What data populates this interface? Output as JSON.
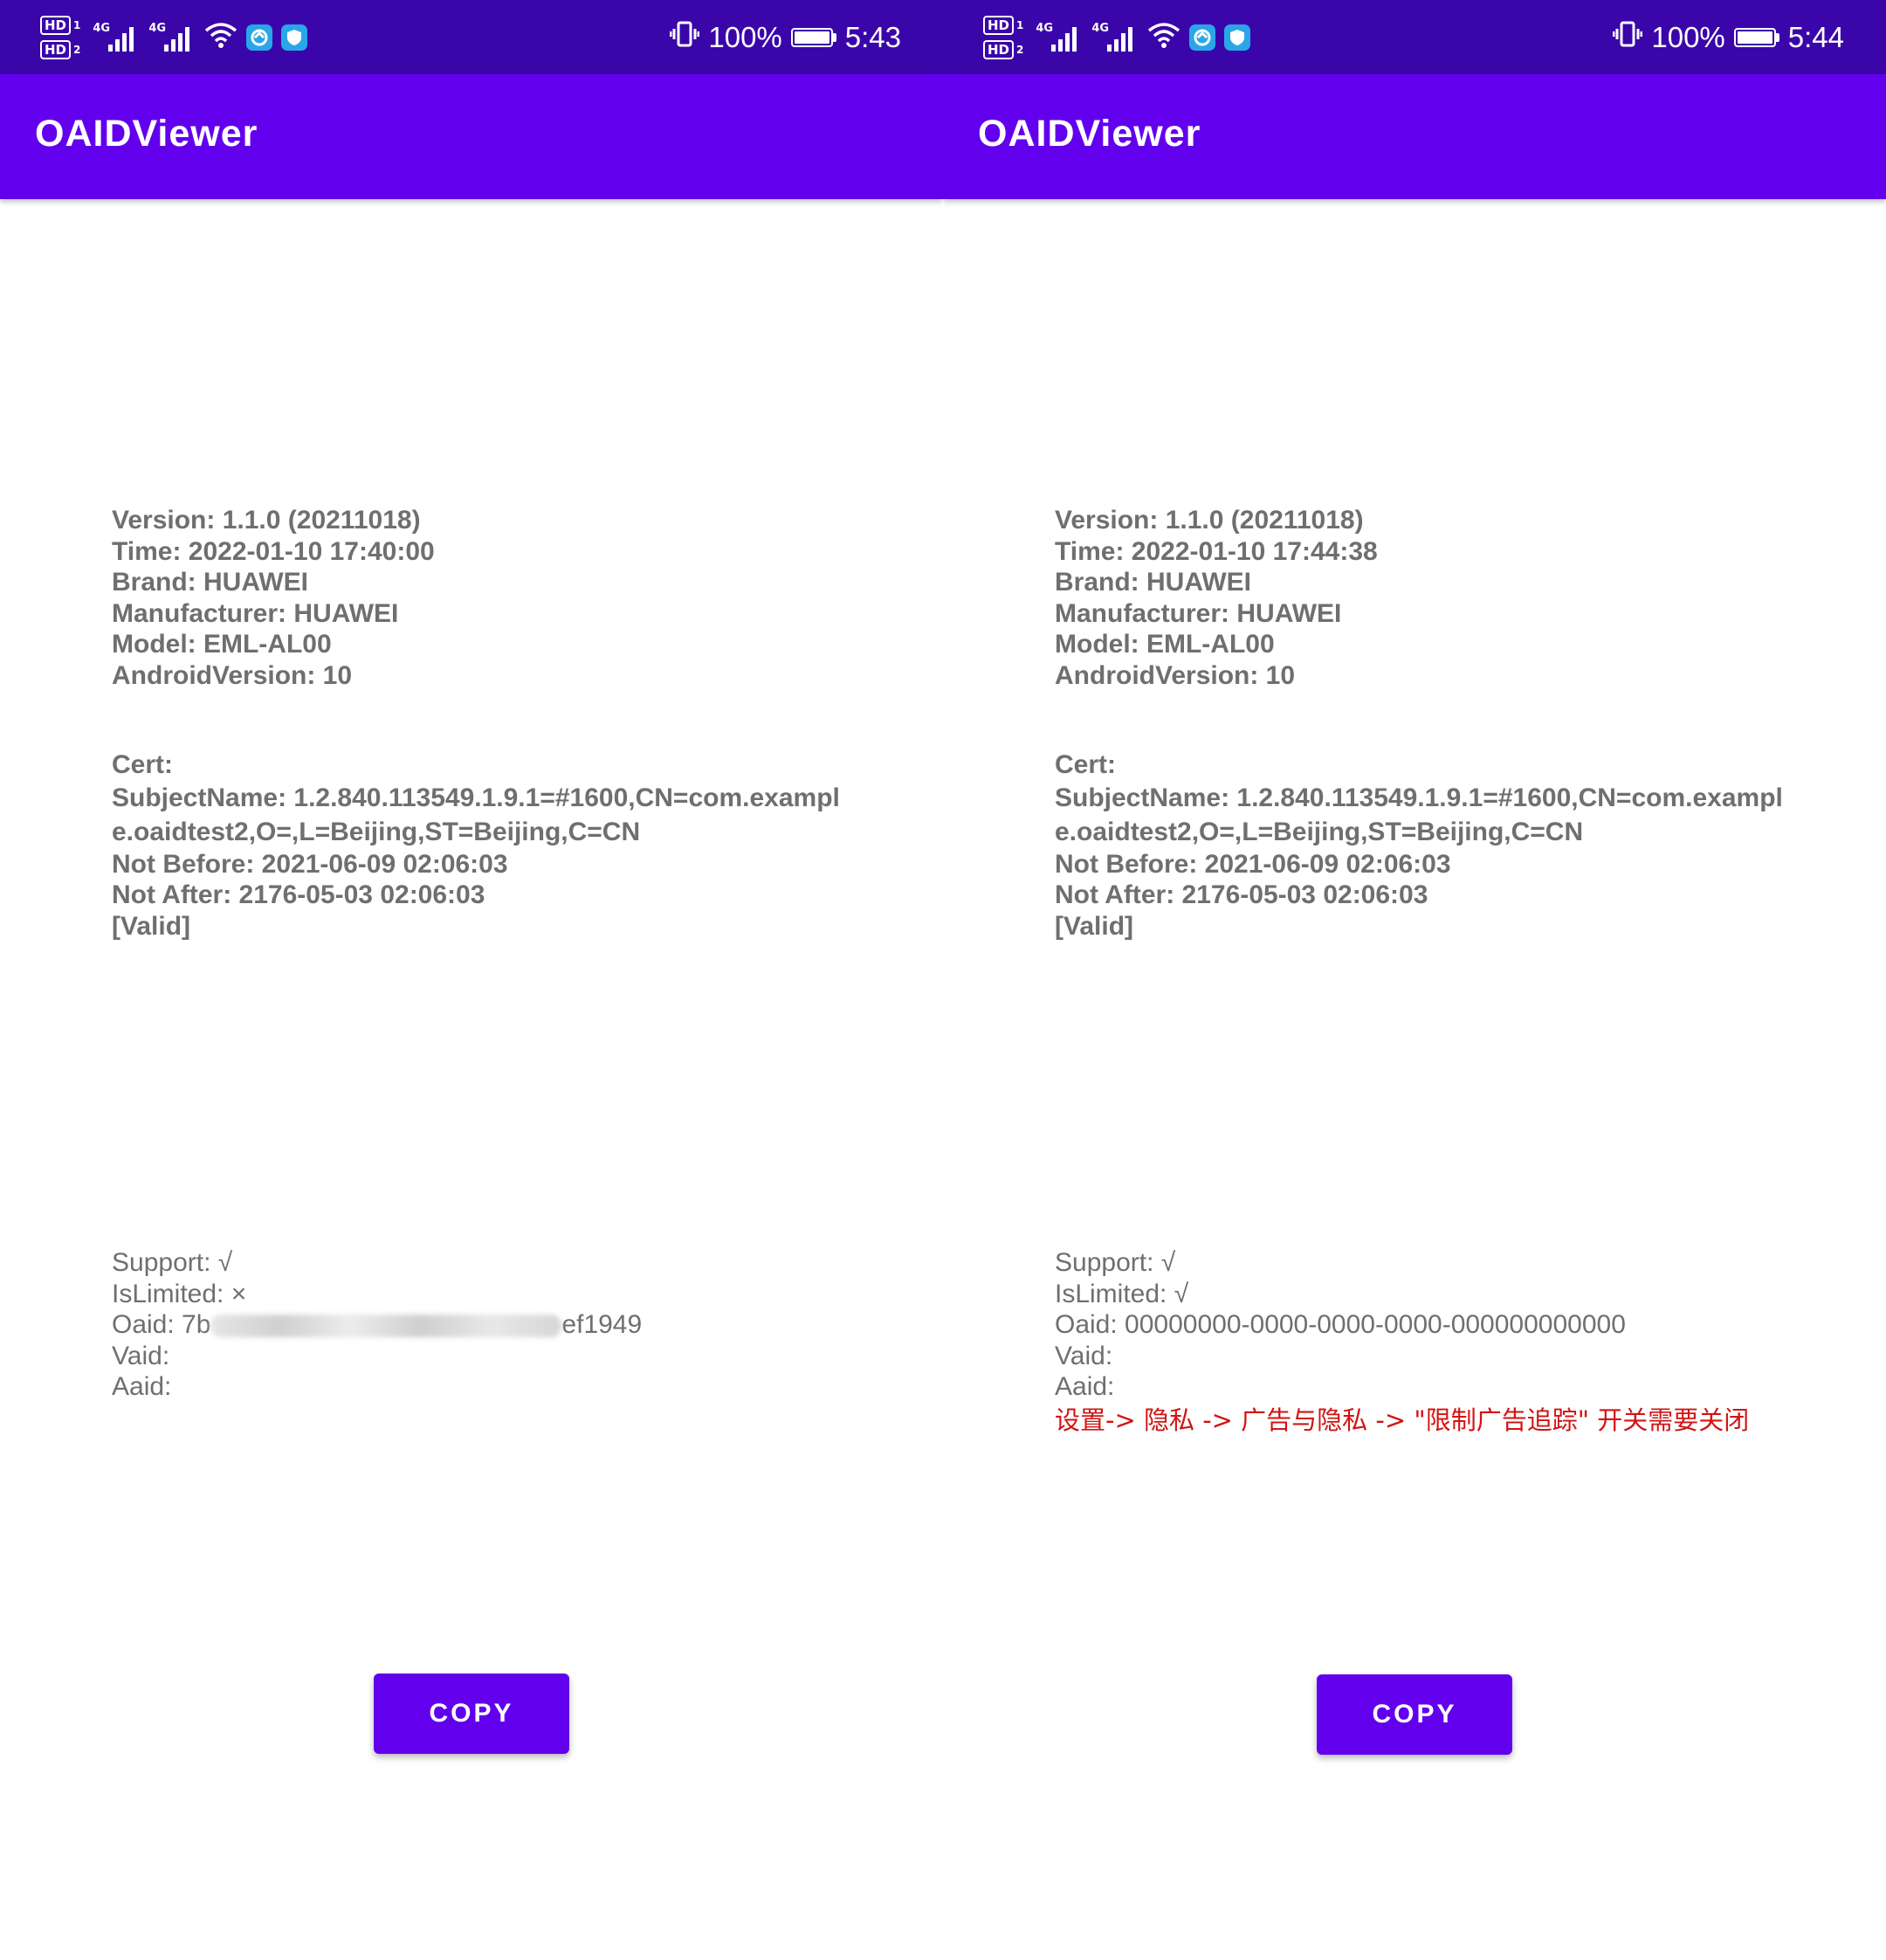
{
  "screens": [
    {
      "status_bar": {
        "hd1": "HD",
        "hd1_sim": "1",
        "hd2": "HD",
        "hd2_sim": "2",
        "signal1_gen": "4G",
        "signal2_gen": "4G",
        "battery_percent": "100%",
        "time": "5:43",
        "icons": [
          "vibrate-icon",
          "wifi-icon",
          "app-notification-icon",
          "shield-icon",
          "battery-icon"
        ]
      },
      "app_bar": {
        "title": "OAIDViewer"
      },
      "info": {
        "version": "Version: 1.1.0 (20211018)",
        "time": "Time: 2022-01-10 17:40:00",
        "brand": "Brand: HUAWEI",
        "manufacturer": "Manufacturer: HUAWEI",
        "model": "Model: EML-AL00",
        "android_version": "AndroidVersion: 10"
      },
      "cert": {
        "heading": "Cert:",
        "subject_line1": "SubjectName: 1.2.840.113549.1.9.1=#1600,CN=com.exampl",
        "subject_line2": "e.oaidtest2,O=,L=Beijing,ST=Beijing,C=CN",
        "not_before": "Not Before: 2021-06-09 02:06:03",
        "not_after": "Not After: 2176-05-03 02:06:03",
        "status": "[Valid]"
      },
      "oaid": {
        "support": "Support: √",
        "is_limited": "IsLimited: ×",
        "oaid_prefix": "Oaid: 7b",
        "oaid_suffix": "ef1949",
        "vaid": "Vaid:",
        "aaid": "Aaid:"
      },
      "copy_button": "COPY"
    },
    {
      "status_bar": {
        "hd1": "HD",
        "hd1_sim": "1",
        "hd2": "HD",
        "hd2_sim": "2",
        "signal1_gen": "4G",
        "signal2_gen": "4G",
        "battery_percent": "100%",
        "time": "5:44",
        "icons": [
          "vibrate-icon",
          "wifi-icon",
          "app-notification-icon",
          "shield-icon",
          "battery-icon"
        ]
      },
      "app_bar": {
        "title": "OAIDViewer"
      },
      "info": {
        "version": "Version: 1.1.0 (20211018)",
        "time": "Time: 2022-01-10 17:44:38",
        "brand": "Brand: HUAWEI",
        "manufacturer": "Manufacturer: HUAWEI",
        "model": "Model: EML-AL00",
        "android_version": "AndroidVersion: 10"
      },
      "cert": {
        "heading": "Cert:",
        "subject_line1": "SubjectName: 1.2.840.113549.1.9.1=#1600,CN=com.exampl",
        "subject_line2": "e.oaidtest2,O=,L=Beijing,ST=Beijing,C=CN",
        "not_before": "Not Before: 2021-06-09 02:06:03",
        "not_after": "Not After: 2176-05-03 02:06:03",
        "status": "[Valid]"
      },
      "oaid": {
        "support": "Support: √",
        "is_limited": "IsLimited: √",
        "oaid": "Oaid: 00000000-0000-0000-0000-000000000000",
        "vaid": "Vaid:",
        "aaid": "Aaid:",
        "hint": "设置-> 隐私 -> 广告与隐私 -> \"限制广告追踪\" 开关需要关闭"
      },
      "copy_button": "COPY"
    }
  ],
  "colors": {
    "status_bar_bg": "#3a06aa",
    "app_bar_bg": "#6200ee",
    "button_bg": "#6200ee",
    "text_gray": "#6f6f6f",
    "hint_red": "#d21414"
  }
}
